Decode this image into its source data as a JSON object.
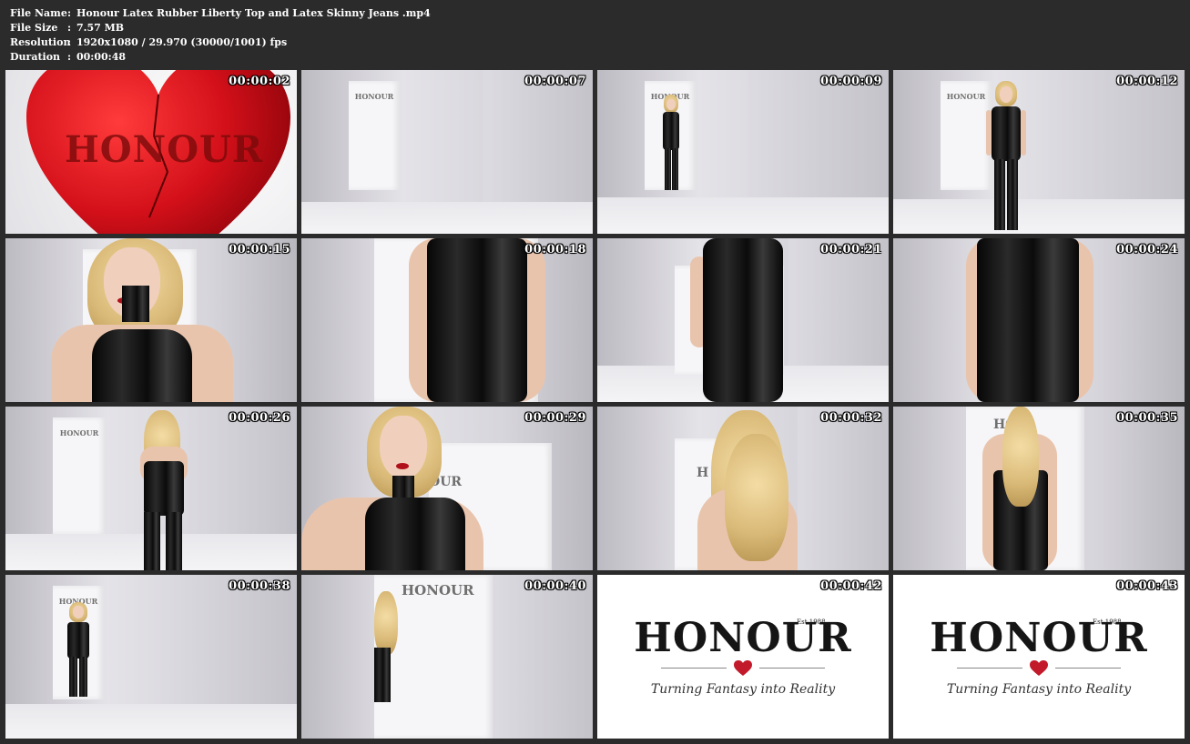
{
  "header": {
    "rows": [
      {
        "label": "File Name",
        "sep": ":",
        "value": "Honour Latex Rubber Liberty Top and Latex Skinny Jeans .mp4"
      },
      {
        "label": "File Size",
        "sep": ":",
        "value": "7.57 MB"
      },
      {
        "label": "Resolution",
        "sep": ":",
        "value": "1920x1080 / 29.970 (30000/1001) fps"
      },
      {
        "label": "Duration",
        "sep": ":",
        "value": "00:00:48"
      }
    ]
  },
  "thumbnails": [
    {
      "time": "00:00:02",
      "logo_text": "HONOUR"
    },
    {
      "time": "00:00:07",
      "logo_text": "HONOUR"
    },
    {
      "time": "00:00:09",
      "logo_text": "HONOUR"
    },
    {
      "time": "00:00:12",
      "logo_text": "HONOUR"
    },
    {
      "time": "00:00:15"
    },
    {
      "time": "00:00:18"
    },
    {
      "time": "00:00:21"
    },
    {
      "time": "00:00:24"
    },
    {
      "time": "00:00:26",
      "logo_text": "HONOUR"
    },
    {
      "time": "00:00:29",
      "logo_text": "OUR"
    },
    {
      "time": "00:00:32",
      "logo_text": "H"
    },
    {
      "time": "00:00:35",
      "logo_text": "HO"
    },
    {
      "time": "00:00:38",
      "logo_text": "HONOUR"
    },
    {
      "time": "00:00:40",
      "logo_text": "HONOUR"
    },
    {
      "time": "00:00:42",
      "logo_text": "HONOUR",
      "est": "Est 1988",
      "tagline": "Turning Fantasy into Reality"
    },
    {
      "time": "00:00:43",
      "logo_text": "HONOUR",
      "est": "Est 1988",
      "tagline": "Turning Fantasy into Reality"
    }
  ],
  "colors": {
    "background": "#2b2b2b",
    "text": "#ffffff",
    "heart_red": "#d4101a",
    "latex_black": "#0a0a0a"
  }
}
